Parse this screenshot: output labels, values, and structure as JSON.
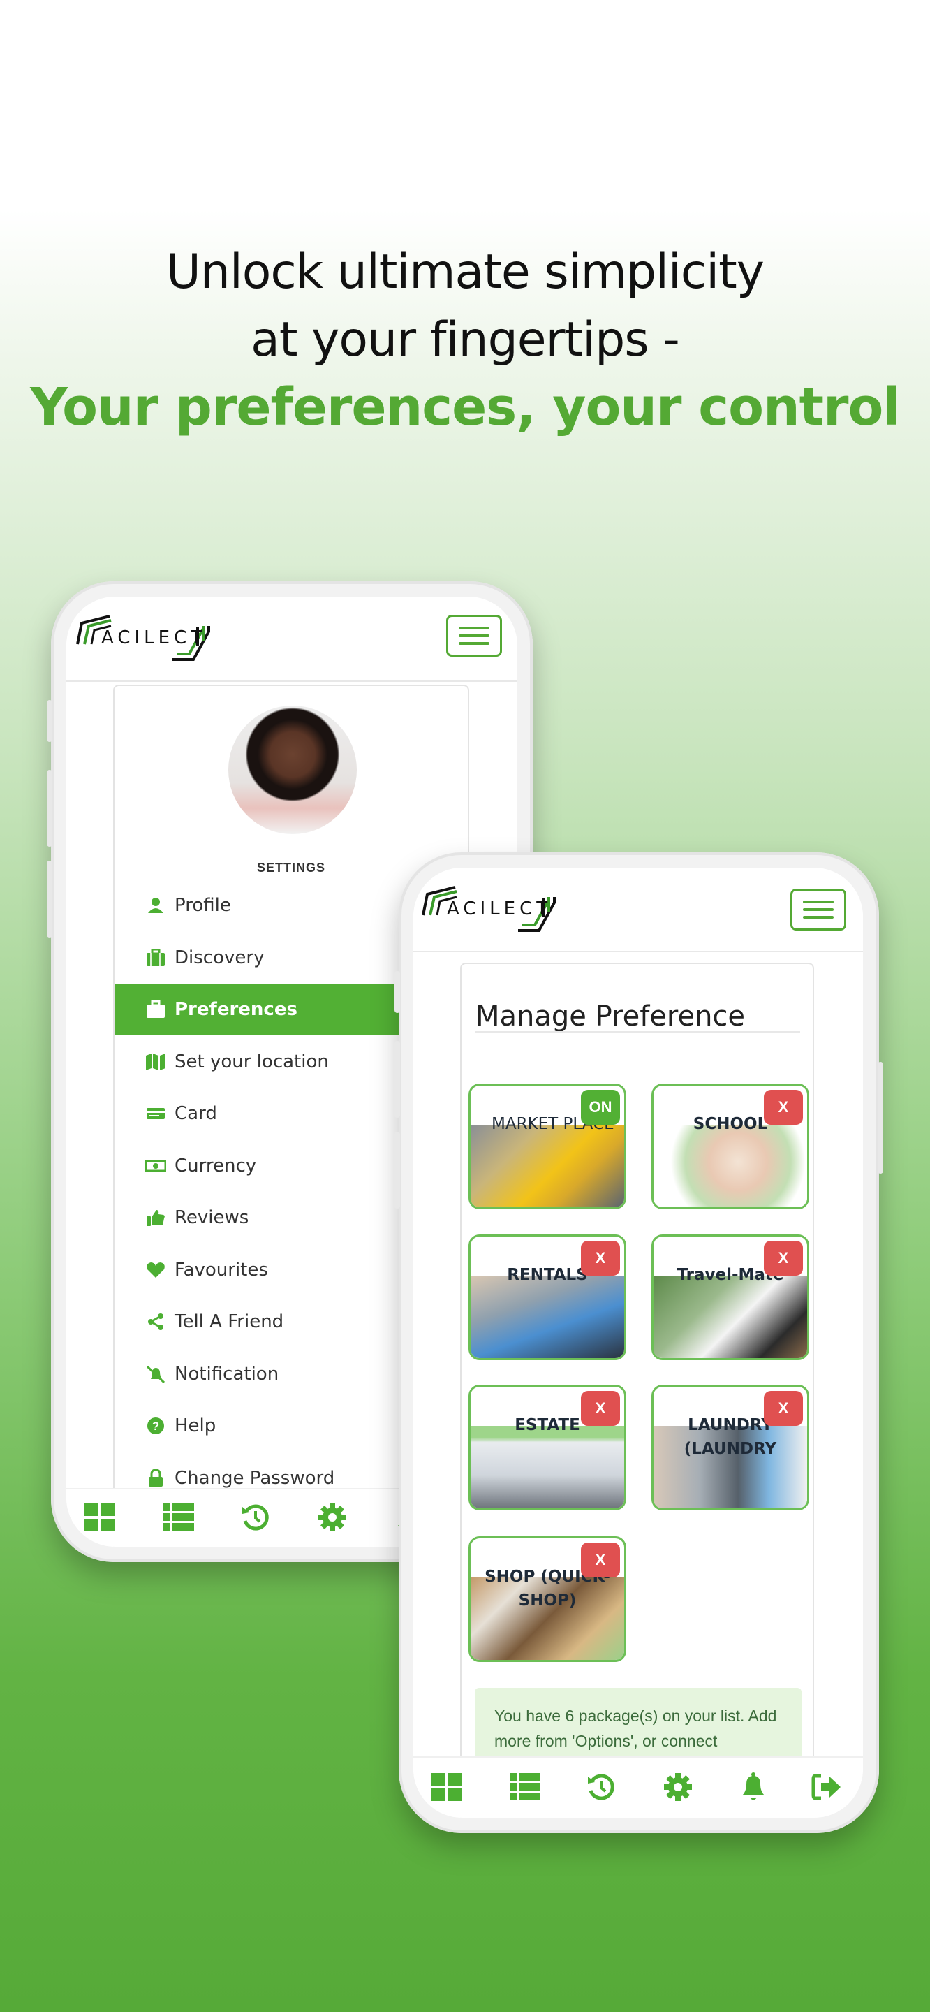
{
  "headline": {
    "line1": "Unlock ultimate simplicity",
    "line2": "at your fingertips -",
    "line3": "Your preferences, your control"
  },
  "colors": {
    "brand_green": "#54a934",
    "active_bg": "#52b034",
    "close_badge": "#e05050",
    "info_bg": "#e6f5de"
  },
  "logo": {
    "text": "ACILECT"
  },
  "settings_screen": {
    "section_title": "SETTINGS",
    "menu": [
      {
        "label": "Profile",
        "icon": "user-icon"
      },
      {
        "label": "Discovery",
        "icon": "briefcase-icon"
      },
      {
        "label": "Preferences",
        "icon": "briefcase-icon",
        "active": true
      },
      {
        "label": "Set your location",
        "icon": "map-icon"
      },
      {
        "label": "Card",
        "icon": "credit-card-icon"
      },
      {
        "label": "Currency",
        "icon": "money-icon"
      },
      {
        "label": "Reviews",
        "icon": "thumbs-up-icon"
      },
      {
        "label": "Favourites",
        "icon": "heart-icon"
      },
      {
        "label": "Tell A Friend",
        "icon": "share-icon"
      },
      {
        "label": "Notification",
        "icon": "bell-slash-icon"
      },
      {
        "label": "Help",
        "icon": "question-circle-icon"
      },
      {
        "label": "Change Password",
        "icon": "lock-icon"
      }
    ]
  },
  "preference_screen": {
    "title": "Manage Preference",
    "tiles": [
      {
        "label": "MARKET PLACE",
        "status": "ON"
      },
      {
        "label": "SCHOOL",
        "status": "X"
      },
      {
        "label": "RENTALS",
        "status": "X"
      },
      {
        "label": "Travel-Mate",
        "status": "X"
      },
      {
        "label": "ESTATE",
        "status": "X"
      },
      {
        "label": "LAUNDRY (LAUNDRY",
        "status": "X"
      },
      {
        "label": "SHOP (QUICK-SHOP)",
        "status": "X"
      }
    ],
    "info_text": "You have 6 package(s) on your list. Add more from 'Options', or connect"
  },
  "bottom_nav": [
    "dashboard-icon",
    "list-icon",
    "history-icon",
    "settings-icon",
    "bell-icon",
    "logout-icon"
  ]
}
